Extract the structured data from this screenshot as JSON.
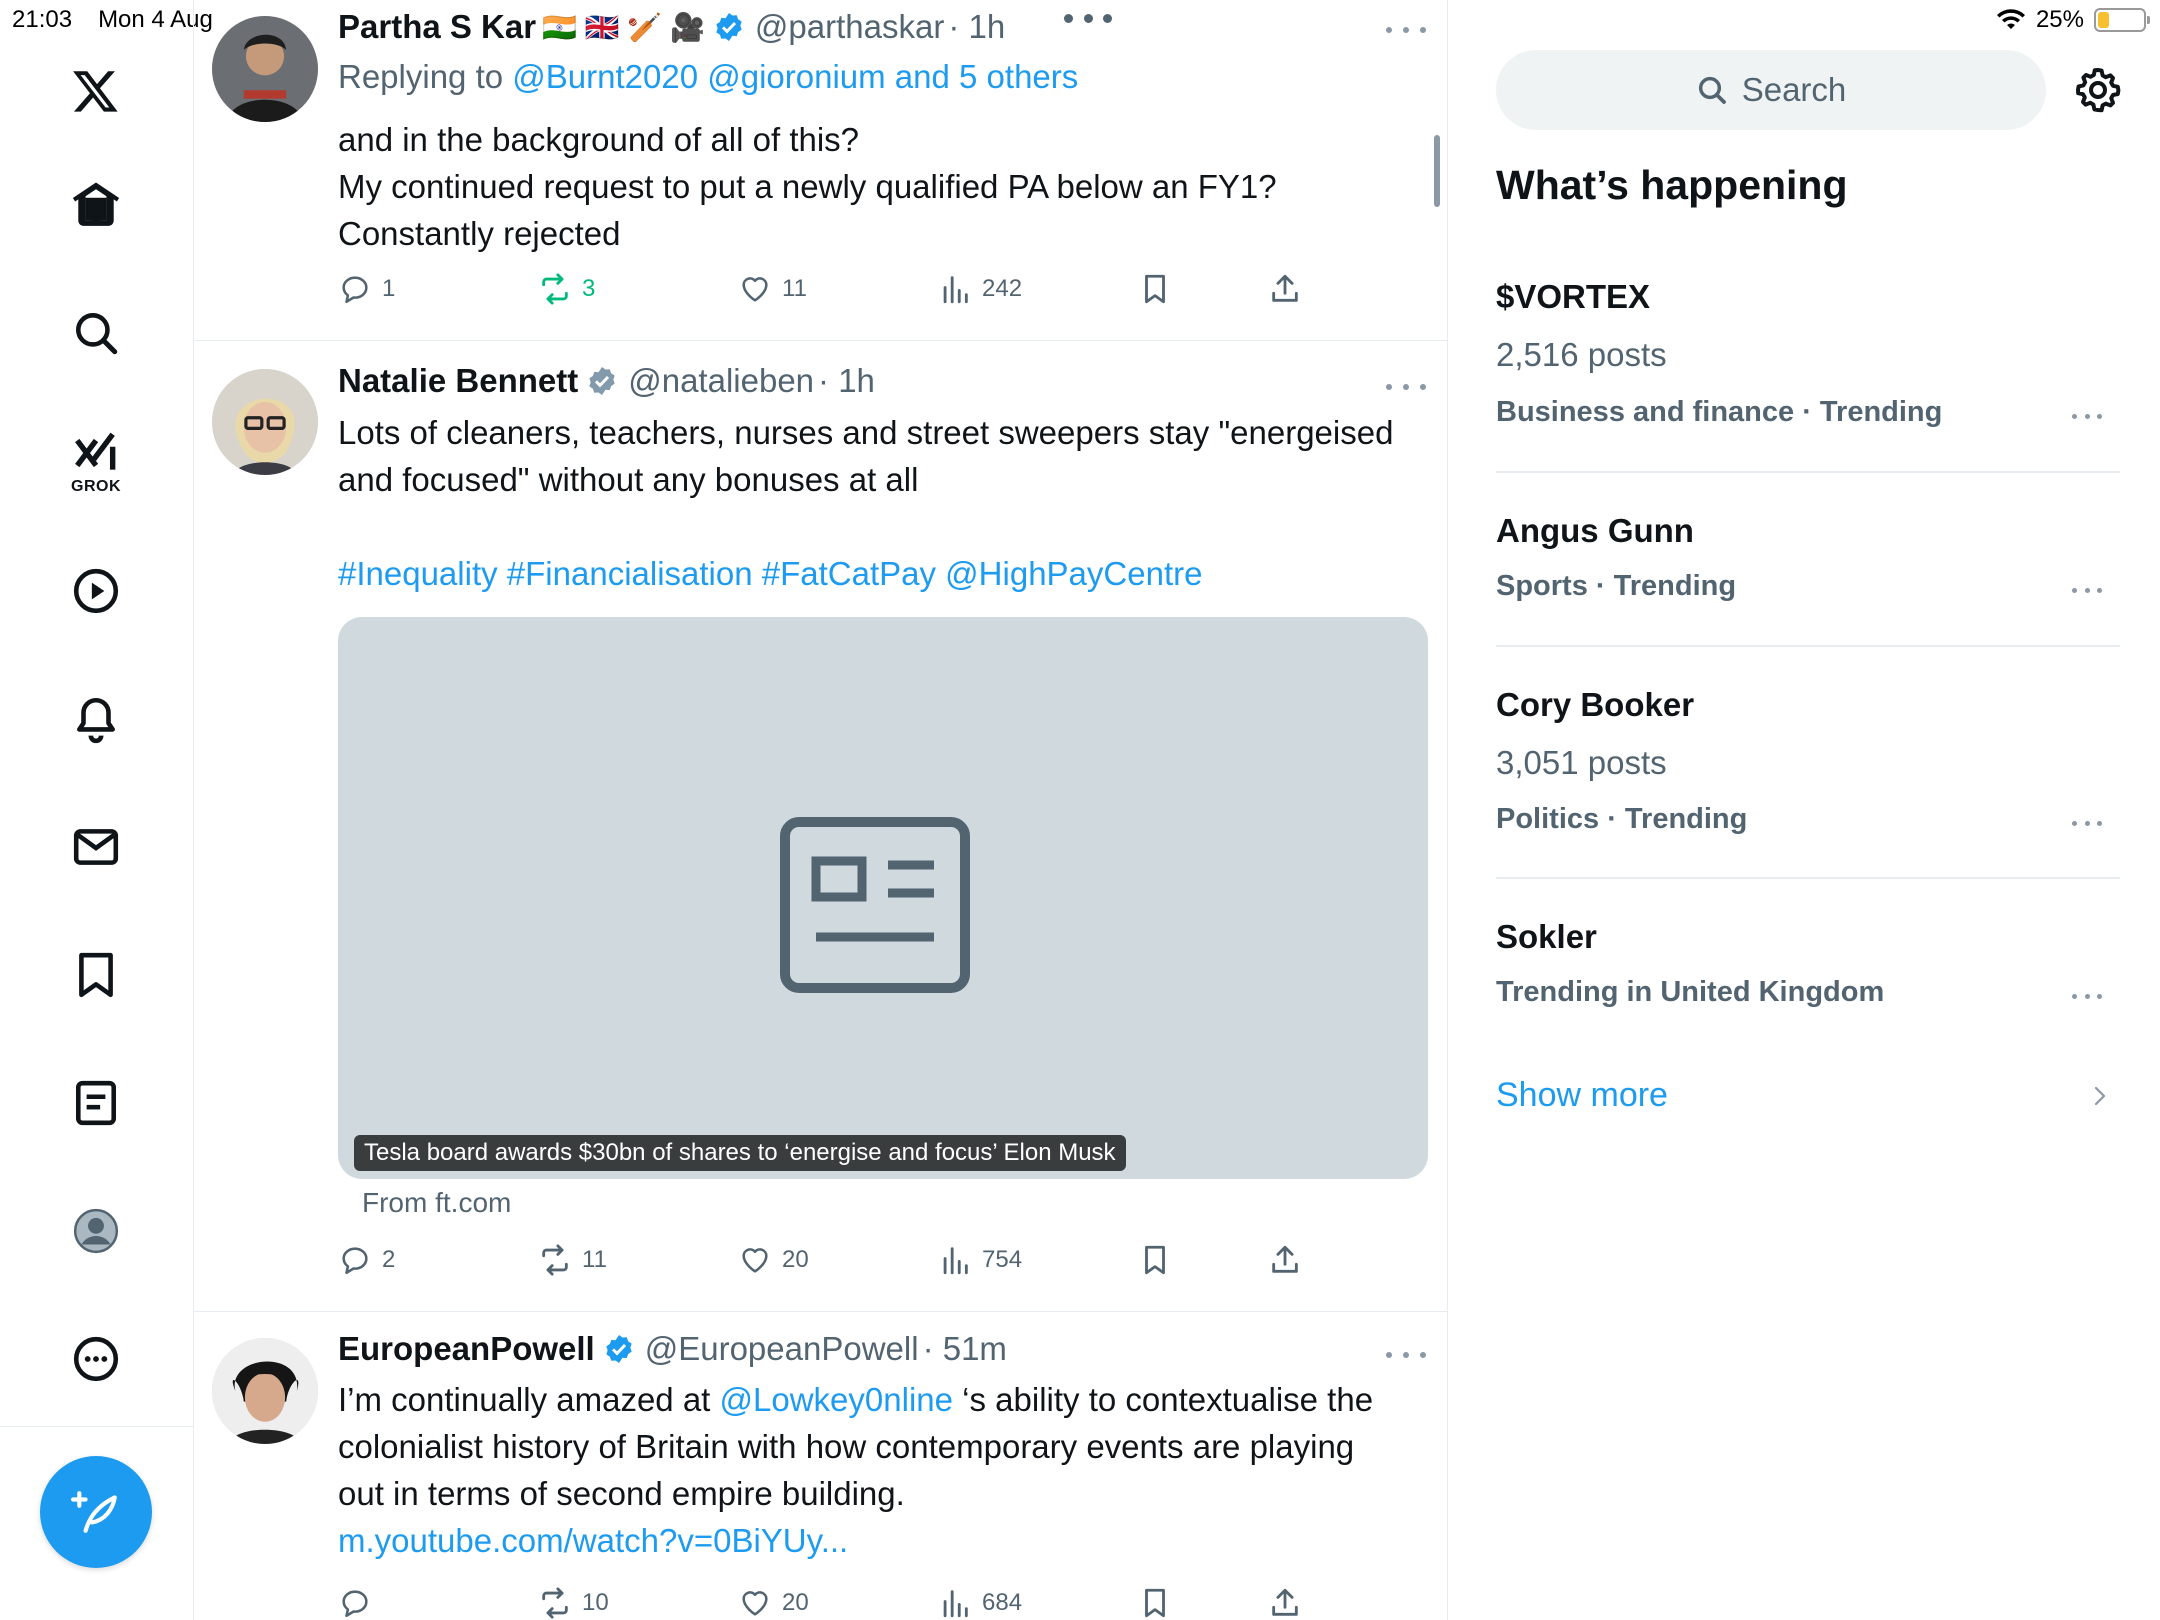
{
  "status_bar": {
    "time": "21:03",
    "date": "Mon 4 Aug",
    "battery": "25%",
    "battery_level": 0.25
  },
  "sidebar": {
    "items": [
      {
        "name": "home-icon"
      },
      {
        "name": "explore-icon"
      },
      {
        "name": "grok-icon",
        "label": "GROK"
      },
      {
        "name": "video-icon"
      },
      {
        "name": "notifications-icon"
      },
      {
        "name": "messages-icon"
      },
      {
        "name": "bookmarks-icon"
      },
      {
        "name": "lists-icon"
      },
      {
        "name": "profile-icon"
      },
      {
        "name": "more-icon"
      }
    ],
    "compose_icon": "compose-icon"
  },
  "posts": [
    {
      "name": "Partha S Kar",
      "flags": "🇮🇳 🇬🇧 🏏 🎥",
      "handle": "@parthaskar",
      "time": "· 1h",
      "replying_prefix": "Replying to ",
      "replying_to": "@Burnt2020 @gioronium and 5 others",
      "lines": [
        "and in the background of all of this?",
        "My continued request to put a newly qualified PA below an FY1?",
        "Constantly rejected"
      ],
      "stats": {
        "replies": "1",
        "reposts": "3",
        "likes": "11",
        "views": "242"
      }
    },
    {
      "name": "Natalie Bennett",
      "handle": "@natalieben",
      "time": "· 1h",
      "lines": [
        "Lots of cleaners, teachers, nurses and street sweepers stay \"energeised",
        "and focused\" without any bonuses at all"
      ],
      "hashtags": "#Inequality #Financialisation #FatCatPay @HighPayCentre",
      "card_caption": "Tesla board awards $30bn of shares to ‘energise and focus’ Elon Musk",
      "card_source": "From ft.com",
      "stats": {
        "replies": "2",
        "reposts": "11",
        "likes": "20",
        "views": "754"
      }
    },
    {
      "name": "EuropeanPowell",
      "handle": "@EuropeanPowell",
      "time": "· 51m",
      "line1_prefix": "I’m continually amazed at ",
      "line1_mention": "@Lowkey0nline",
      "line1_suffix": " ‘s ability to contextualise the",
      "lines": [
        "colonialist history of Britain with how contemporary events are playing",
        "out in terms of second empire building."
      ],
      "link": "m.youtube.com/watch?v=0BiYUy...",
      "stats": {
        "replies": "",
        "reposts": "10",
        "likes": "20",
        "views": "684"
      }
    }
  ],
  "right": {
    "search_placeholder": "Search",
    "title": "What’s happening",
    "trends": [
      {
        "name": "$VORTEX",
        "posts": "2,516 posts",
        "category": "Business and finance · Trending"
      },
      {
        "name": "Angus Gunn",
        "posts": "",
        "category": "Sports · Trending"
      },
      {
        "name": "Cory Booker",
        "posts": "3,051 posts",
        "category": "Politics · Trending"
      },
      {
        "name": "Sokler",
        "posts": "",
        "category": "Trending in United Kingdom"
      }
    ],
    "show_more": "Show more"
  },
  "colors": {
    "accent": "#1d9bf0",
    "repost_active": "#00ba7c",
    "text": "#0f1419",
    "secondary": "#536471"
  }
}
